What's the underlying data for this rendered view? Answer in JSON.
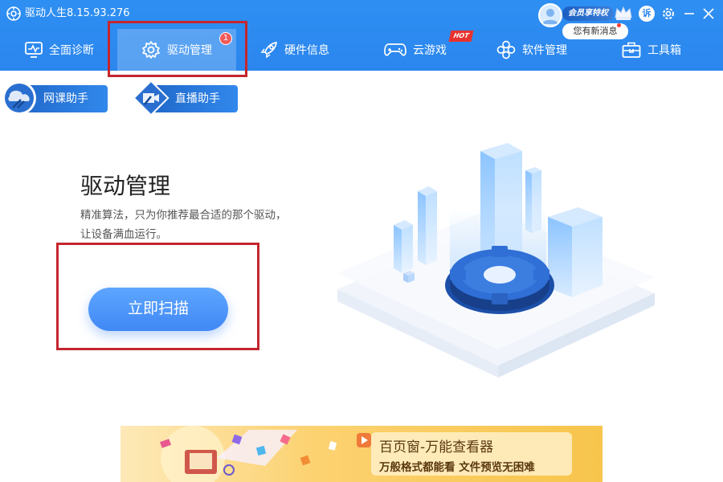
{
  "app": {
    "title": "驱动人生8.15.93.276",
    "vip_label": "会员享特权",
    "news_label": "您有新消息",
    "feedback_label": "诉"
  },
  "nav": {
    "tabs": [
      {
        "label": "全面诊断",
        "icon": "monitor-icon"
      },
      {
        "label": "驱动管理",
        "icon": "gear-icon",
        "active": true,
        "badge": "1"
      },
      {
        "label": "硬件信息",
        "icon": "rocket-icon"
      },
      {
        "label": "云游戏",
        "icon": "gamepad-icon",
        "tag": "HOT"
      },
      {
        "label": "软件管理",
        "icon": "flower-icon"
      },
      {
        "label": "工具箱",
        "icon": "toolbox-icon"
      }
    ]
  },
  "assistants": [
    {
      "label": "网课助手",
      "icon": "network-class-icon"
    },
    {
      "label": "直播助手",
      "icon": "live-stream-icon"
    }
  ],
  "main": {
    "title": "驱动管理",
    "description_line1": "精准算法，只为你推荐最合适的那个驱动，",
    "description_line2": "让设备满血运行。",
    "scan_button": "立即扫描"
  },
  "banner": {
    "title": "百页窗-万能查看器",
    "subtitle": "万般格式都能看  文件预览无困难"
  },
  "colors": {
    "header_blue": "#2b86ee",
    "highlight_red": "#c4262e",
    "scan_button_blue": "#4a92f7",
    "banner_yellow": "#fcd271"
  }
}
